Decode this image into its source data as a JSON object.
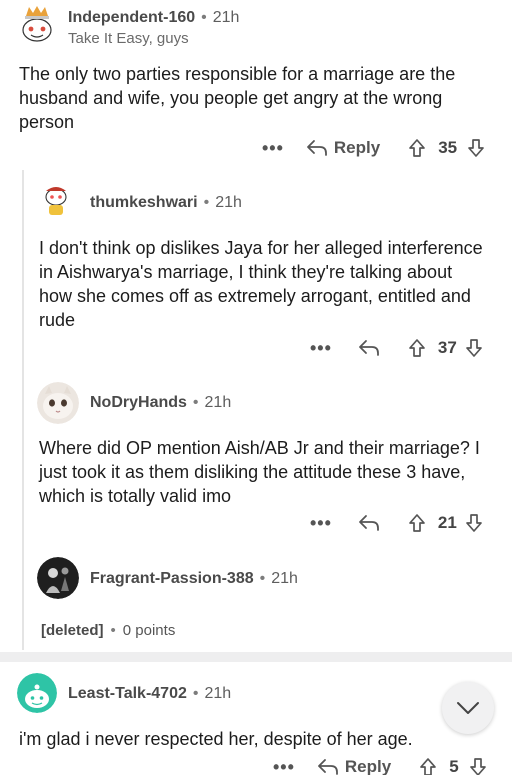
{
  "comments": [
    {
      "username": "Independent-160",
      "time": "21h",
      "flair": "Take It Easy, guys",
      "body": "The only two parties responsible for a marriage are the husband and wife, you people get angry at the wrong person",
      "reply_label": "Reply",
      "votes": "35"
    },
    {
      "username": "thumkeshwari",
      "time": "21h",
      "body": "I don't think op dislikes Jaya for her alleged interference in Aishwarya's marriage, I think they're talking about how she comes off as extremely arrogant, entitled and rude",
      "votes": "37"
    },
    {
      "username": "NoDryHands",
      "time": "21h",
      "body": "Where did OP mention Aish/AB Jr and their marriage? I just took it as them disliking the attitude these 3 have, which is totally valid imo",
      "votes": "21"
    },
    {
      "username": "Fragrant-Passion-388",
      "time": "21h",
      "deleted_label": "[deleted]",
      "points": "0 points"
    },
    {
      "username": "Least-Talk-4702",
      "time": "21h",
      "body": "i'm glad i never respected her, despite of her age.",
      "reply_label": "Reply",
      "votes": "5"
    }
  ],
  "separator_dot": "•",
  "more_glyph": "•••",
  "icons": {
    "reply": "reply-arrow-icon",
    "upvote": "upvote-arrow-icon",
    "downvote": "downvote-arrow-icon",
    "scroll_down": "chevron-down-icon"
  },
  "colors": {
    "snoo_green": "#2ec4a6",
    "line": "#e4e4e4"
  }
}
